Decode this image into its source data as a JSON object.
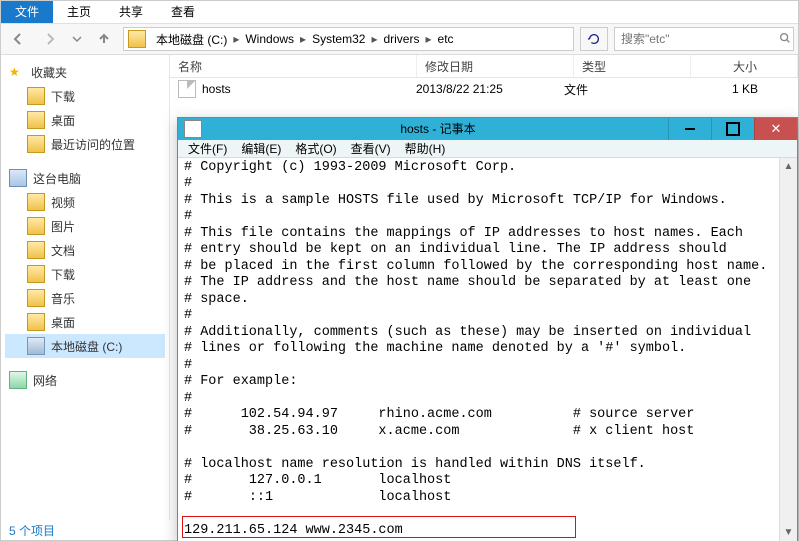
{
  "explorer": {
    "tabs": {
      "file": "文件",
      "home": "主页",
      "share": "共享",
      "view": "查看"
    },
    "breadcrumb": [
      "本地磁盘 (C:)",
      "Windows",
      "System32",
      "drivers",
      "etc"
    ],
    "search_placeholder": "搜索\"etc\"",
    "columns": {
      "name": "名称",
      "date": "修改日期",
      "type": "类型",
      "size": "大小"
    },
    "row": {
      "name": "hosts",
      "date": "2013/8/22 21:25",
      "type": "文件",
      "size": "1 KB"
    },
    "status": "5 个项目",
    "nav": {
      "favorites": "收藏夹",
      "downloads": "下载",
      "desktop": "桌面",
      "recent": "最近访问的位置",
      "computer": "这台电脑",
      "videos": "视频",
      "pictures": "图片",
      "documents": "文档",
      "downloads2": "下载",
      "music": "音乐",
      "desktop2": "桌面",
      "cdrive": "本地磁盘 (C:)",
      "network": "网络"
    }
  },
  "notepad": {
    "title": "hosts - 记事本",
    "menus": {
      "file": "文件(F)",
      "edit": "编辑(E)",
      "format": "格式(O)",
      "view": "查看(V)",
      "help": "帮助(H)"
    },
    "lines": [
      "# Copyright (c) 1993-2009 Microsoft Corp.",
      "#",
      "# This is a sample HOSTS file used by Microsoft TCP/IP for Windows.",
      "#",
      "# This file contains the mappings of IP addresses to host names. Each",
      "# entry should be kept on an individual line. The IP address should",
      "# be placed in the first column followed by the corresponding host name.",
      "# The IP address and the host name should be separated by at least one",
      "# space.",
      "#",
      "# Additionally, comments (such as these) may be inserted on individual",
      "# lines or following the machine name denoted by a '#' symbol.",
      "#",
      "# For example:",
      "#",
      "#      102.54.94.97     rhino.acme.com          # source server",
      "#       38.25.63.10     x.acme.com              # x client host",
      "",
      "# localhost name resolution is handled within DNS itself.",
      "#\t127.0.0.1       localhost",
      "#\t::1             localhost",
      "",
      "129.211.65.124 www.2345.com"
    ]
  }
}
